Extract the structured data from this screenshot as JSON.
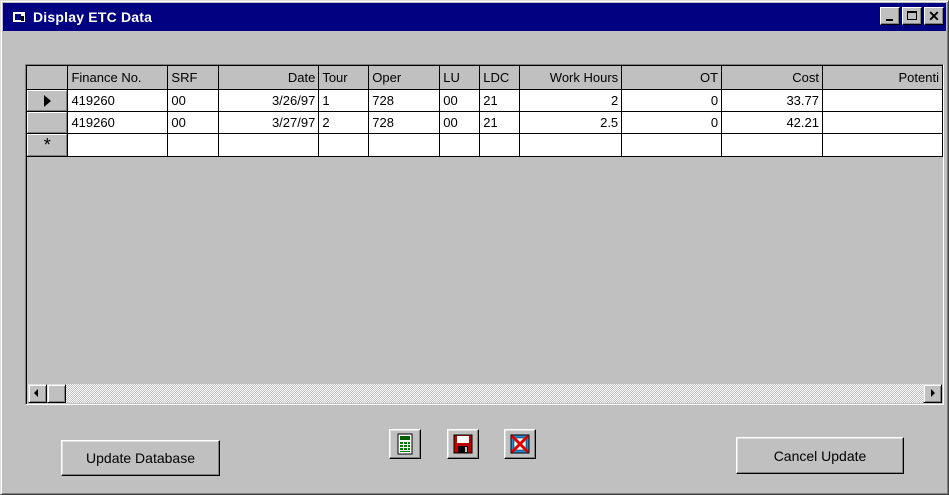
{
  "window": {
    "title": "Display ETC Data",
    "icon": "app-icon",
    "controls": [
      "minimize-icon",
      "maximize-icon",
      "close-icon"
    ]
  },
  "grid": {
    "columns": [
      "Finance No.",
      "SRF",
      "Date",
      "Tour",
      "Oper",
      "LU",
      "LDC",
      "Work Hours",
      "OT",
      "Cost",
      "Potenti"
    ],
    "rows": [
      {
        "indicator": "current-row-arrow",
        "cells": [
          "419260",
          "00",
          "3/26/97",
          "1",
          "728",
          "00",
          "21",
          "2",
          "0",
          "33.77",
          ""
        ]
      },
      {
        "indicator": "",
        "cells": [
          "419260",
          "00",
          "3/27/97",
          "2",
          "728",
          "00",
          "21",
          "2.5",
          "0",
          "42.21",
          ""
        ]
      }
    ],
    "new_row_marker": "*"
  },
  "buttons": {
    "update_database": "Update Database",
    "cancel_update": "Cancel Update",
    "icons": [
      "calculator-icon",
      "save-icon",
      "delete-icon"
    ]
  },
  "colors": {
    "title_bar": "#000080",
    "face": "#c0c0c0",
    "calculator_green": "#008000",
    "save_red": "#c00000"
  }
}
